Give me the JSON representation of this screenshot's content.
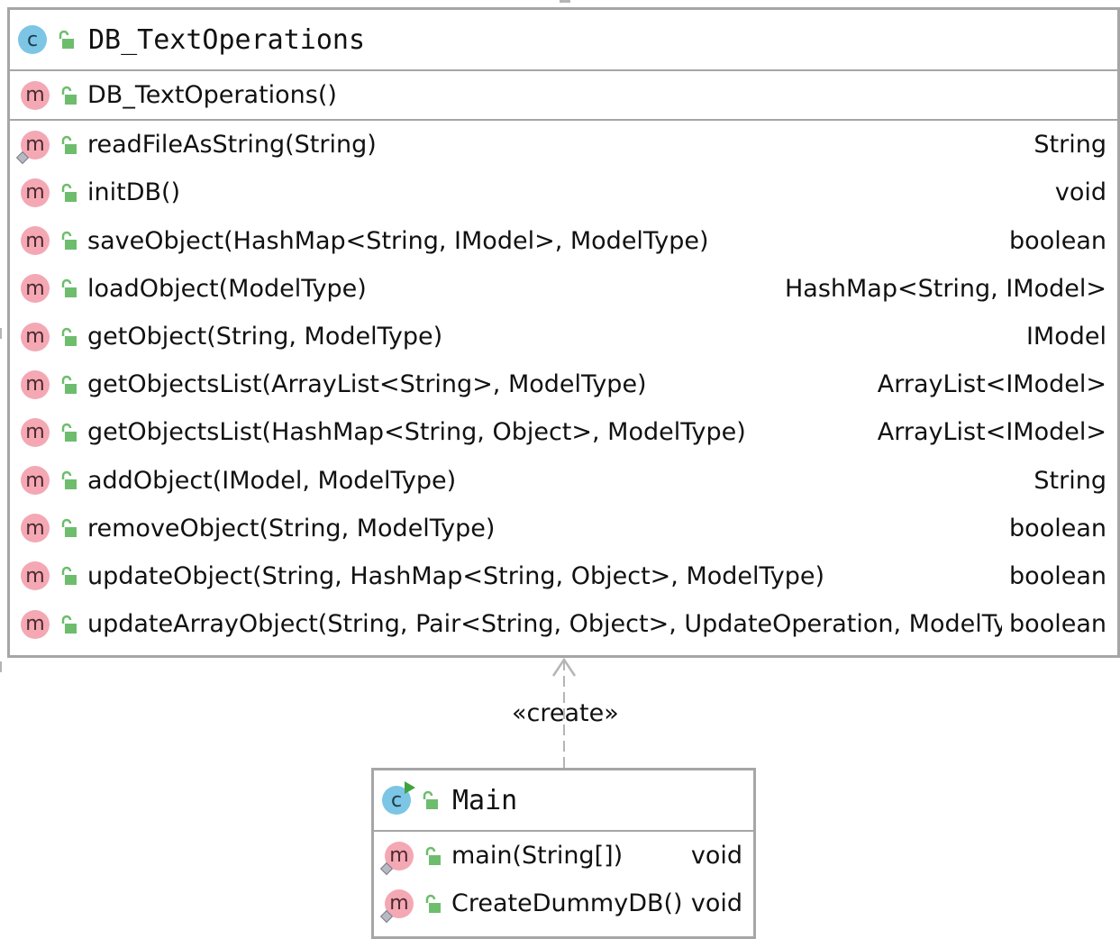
{
  "classes": {
    "db_text_operations": {
      "name": "DB_TextOperations",
      "constructors": [
        {
          "name": "DB_TextOperations()",
          "type": ""
        }
      ],
      "methods": [
        {
          "name": "readFileAsString(String)",
          "type": "String",
          "static": true
        },
        {
          "name": "initDB()",
          "type": "void"
        },
        {
          "name": "saveObject(HashMap<String, IModel>, ModelType)",
          "type": "boolean"
        },
        {
          "name": "loadObject(ModelType)",
          "type": "HashMap<String, IModel>"
        },
        {
          "name": "getObject(String, ModelType)",
          "type": "IModel"
        },
        {
          "name": "getObjectsList(ArrayList<String>, ModelType)",
          "type": "ArrayList<IModel>"
        },
        {
          "name": "getObjectsList(HashMap<String, Object>, ModelType)",
          "type": "ArrayList<IModel>"
        },
        {
          "name": "addObject(IModel, ModelType)",
          "type": "String"
        },
        {
          "name": "removeObject(String, ModelType)",
          "type": "boolean"
        },
        {
          "name": "updateObject(String, HashMap<String, Object>, ModelType)",
          "type": "boolean"
        },
        {
          "name": "updateArrayObject(String, Pair<String, Object>, UpdateOperation, ModelType)",
          "type": "boolean"
        }
      ]
    },
    "main": {
      "name": "Main",
      "methods": [
        {
          "name": "main(String[])",
          "type": "void",
          "static": true
        },
        {
          "name": "CreateDummyDB()",
          "type": "void",
          "static": true
        }
      ]
    }
  },
  "relation": {
    "stereotype": "«create»",
    "from": "Main",
    "to": "DB_TextOperations"
  },
  "icons": {
    "class": "c",
    "method": "m"
  },
  "colors": {
    "border": "#a6a6a6",
    "method_badge": "#f4a8b4",
    "class_badge": "#7cc5e5",
    "lock": "#6dbd6d",
    "arrow": "#b5b5b5"
  }
}
